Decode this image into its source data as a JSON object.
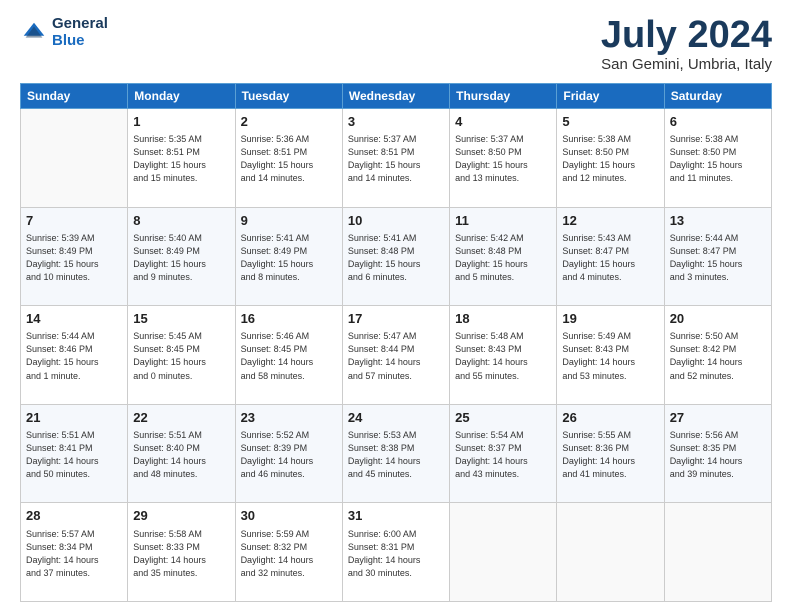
{
  "header": {
    "logo_line1": "General",
    "logo_line2": "Blue",
    "month_title": "July 2024",
    "location": "San Gemini, Umbria, Italy"
  },
  "weekdays": [
    "Sunday",
    "Monday",
    "Tuesday",
    "Wednesday",
    "Thursday",
    "Friday",
    "Saturday"
  ],
  "weeks": [
    [
      {
        "day": "",
        "info": ""
      },
      {
        "day": "1",
        "info": "Sunrise: 5:35 AM\nSunset: 8:51 PM\nDaylight: 15 hours\nand 15 minutes."
      },
      {
        "day": "2",
        "info": "Sunrise: 5:36 AM\nSunset: 8:51 PM\nDaylight: 15 hours\nand 14 minutes."
      },
      {
        "day": "3",
        "info": "Sunrise: 5:37 AM\nSunset: 8:51 PM\nDaylight: 15 hours\nand 14 minutes."
      },
      {
        "day": "4",
        "info": "Sunrise: 5:37 AM\nSunset: 8:50 PM\nDaylight: 15 hours\nand 13 minutes."
      },
      {
        "day": "5",
        "info": "Sunrise: 5:38 AM\nSunset: 8:50 PM\nDaylight: 15 hours\nand 12 minutes."
      },
      {
        "day": "6",
        "info": "Sunrise: 5:38 AM\nSunset: 8:50 PM\nDaylight: 15 hours\nand 11 minutes."
      }
    ],
    [
      {
        "day": "7",
        "info": "Sunrise: 5:39 AM\nSunset: 8:49 PM\nDaylight: 15 hours\nand 10 minutes."
      },
      {
        "day": "8",
        "info": "Sunrise: 5:40 AM\nSunset: 8:49 PM\nDaylight: 15 hours\nand 9 minutes."
      },
      {
        "day": "9",
        "info": "Sunrise: 5:41 AM\nSunset: 8:49 PM\nDaylight: 15 hours\nand 8 minutes."
      },
      {
        "day": "10",
        "info": "Sunrise: 5:41 AM\nSunset: 8:48 PM\nDaylight: 15 hours\nand 6 minutes."
      },
      {
        "day": "11",
        "info": "Sunrise: 5:42 AM\nSunset: 8:48 PM\nDaylight: 15 hours\nand 5 minutes."
      },
      {
        "day": "12",
        "info": "Sunrise: 5:43 AM\nSunset: 8:47 PM\nDaylight: 15 hours\nand 4 minutes."
      },
      {
        "day": "13",
        "info": "Sunrise: 5:44 AM\nSunset: 8:47 PM\nDaylight: 15 hours\nand 3 minutes."
      }
    ],
    [
      {
        "day": "14",
        "info": "Sunrise: 5:44 AM\nSunset: 8:46 PM\nDaylight: 15 hours\nand 1 minute."
      },
      {
        "day": "15",
        "info": "Sunrise: 5:45 AM\nSunset: 8:45 PM\nDaylight: 15 hours\nand 0 minutes."
      },
      {
        "day": "16",
        "info": "Sunrise: 5:46 AM\nSunset: 8:45 PM\nDaylight: 14 hours\nand 58 minutes."
      },
      {
        "day": "17",
        "info": "Sunrise: 5:47 AM\nSunset: 8:44 PM\nDaylight: 14 hours\nand 57 minutes."
      },
      {
        "day": "18",
        "info": "Sunrise: 5:48 AM\nSunset: 8:43 PM\nDaylight: 14 hours\nand 55 minutes."
      },
      {
        "day": "19",
        "info": "Sunrise: 5:49 AM\nSunset: 8:43 PM\nDaylight: 14 hours\nand 53 minutes."
      },
      {
        "day": "20",
        "info": "Sunrise: 5:50 AM\nSunset: 8:42 PM\nDaylight: 14 hours\nand 52 minutes."
      }
    ],
    [
      {
        "day": "21",
        "info": "Sunrise: 5:51 AM\nSunset: 8:41 PM\nDaylight: 14 hours\nand 50 minutes."
      },
      {
        "day": "22",
        "info": "Sunrise: 5:51 AM\nSunset: 8:40 PM\nDaylight: 14 hours\nand 48 minutes."
      },
      {
        "day": "23",
        "info": "Sunrise: 5:52 AM\nSunset: 8:39 PM\nDaylight: 14 hours\nand 46 minutes."
      },
      {
        "day": "24",
        "info": "Sunrise: 5:53 AM\nSunset: 8:38 PM\nDaylight: 14 hours\nand 45 minutes."
      },
      {
        "day": "25",
        "info": "Sunrise: 5:54 AM\nSunset: 8:37 PM\nDaylight: 14 hours\nand 43 minutes."
      },
      {
        "day": "26",
        "info": "Sunrise: 5:55 AM\nSunset: 8:36 PM\nDaylight: 14 hours\nand 41 minutes."
      },
      {
        "day": "27",
        "info": "Sunrise: 5:56 AM\nSunset: 8:35 PM\nDaylight: 14 hours\nand 39 minutes."
      }
    ],
    [
      {
        "day": "28",
        "info": "Sunrise: 5:57 AM\nSunset: 8:34 PM\nDaylight: 14 hours\nand 37 minutes."
      },
      {
        "day": "29",
        "info": "Sunrise: 5:58 AM\nSunset: 8:33 PM\nDaylight: 14 hours\nand 35 minutes."
      },
      {
        "day": "30",
        "info": "Sunrise: 5:59 AM\nSunset: 8:32 PM\nDaylight: 14 hours\nand 32 minutes."
      },
      {
        "day": "31",
        "info": "Sunrise: 6:00 AM\nSunset: 8:31 PM\nDaylight: 14 hours\nand 30 minutes."
      },
      {
        "day": "",
        "info": ""
      },
      {
        "day": "",
        "info": ""
      },
      {
        "day": "",
        "info": ""
      }
    ]
  ]
}
